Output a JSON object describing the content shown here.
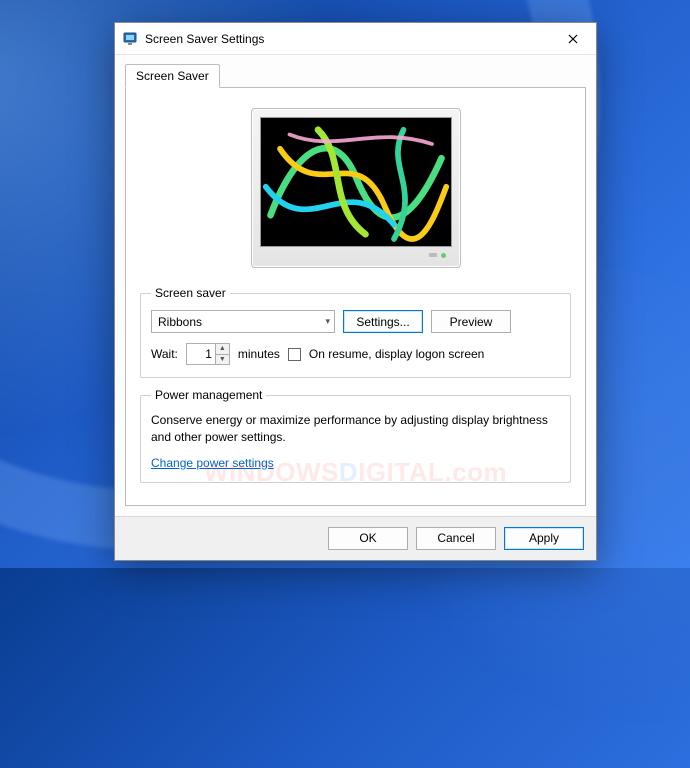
{
  "window": {
    "title": "Screen Saver Settings"
  },
  "tab": {
    "label": "Screen Saver"
  },
  "screensaver_group": {
    "legend": "Screen saver",
    "selected": "Ribbons",
    "settings_button": "Settings...",
    "preview_button": "Preview",
    "wait_label": "Wait:",
    "wait_value": "1",
    "minutes_label": "minutes",
    "resume_checkbox_label": "On resume, display logon screen"
  },
  "power_group": {
    "legend": "Power management",
    "description": "Conserve energy or maximize performance by adjusting display brightness and other power settings.",
    "link": "Change power settings"
  },
  "buttons": {
    "ok": "OK",
    "cancel": "Cancel",
    "apply": "Apply"
  },
  "watermark": {
    "pre": "W",
    "mid": "INDOWS",
    "d": "D",
    "post": "IGITAL.com"
  }
}
